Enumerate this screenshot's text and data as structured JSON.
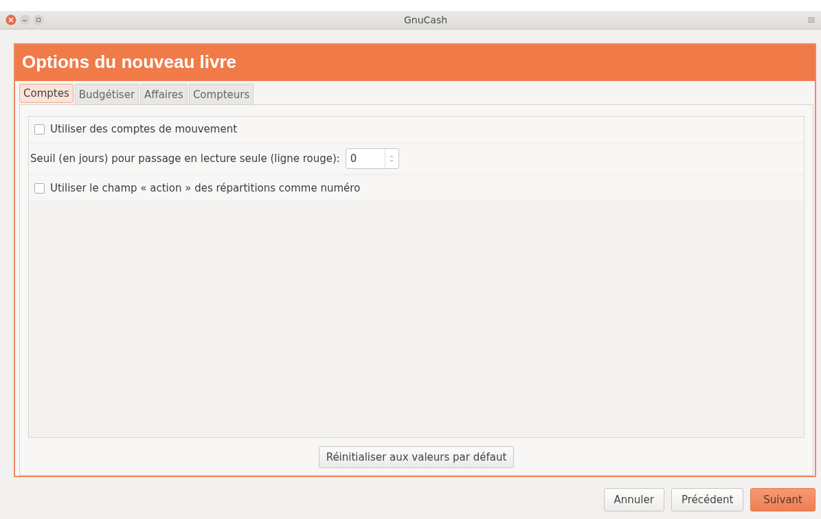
{
  "window": {
    "title": "GnuCash"
  },
  "dialog": {
    "title": "Options du nouveau livre"
  },
  "tabs": [
    {
      "label": "Comptes",
      "selected": true
    },
    {
      "label": "Budgétiser",
      "selected": false
    },
    {
      "label": "Affaires",
      "selected": false
    },
    {
      "label": "Compteurs",
      "selected": false
    }
  ],
  "options": [
    {
      "kind": "checkbox",
      "label": "Utiliser des comptes de mouvement",
      "checked": false
    },
    {
      "kind": "spin",
      "label": "Seuil (en jours) pour passage en lecture seule (ligne rouge):",
      "value": "0"
    },
    {
      "kind": "checkbox",
      "label": "Utiliser le champ « action » des répartitions comme numéro",
      "checked": false
    }
  ],
  "reset_button": "Réinitialiser aux valeurs par défaut",
  "buttons": [
    {
      "label": "Annuler",
      "kind": "normal"
    },
    {
      "label": "Précédent",
      "kind": "normal"
    },
    {
      "label": "Suivant",
      "kind": "primary"
    }
  ]
}
